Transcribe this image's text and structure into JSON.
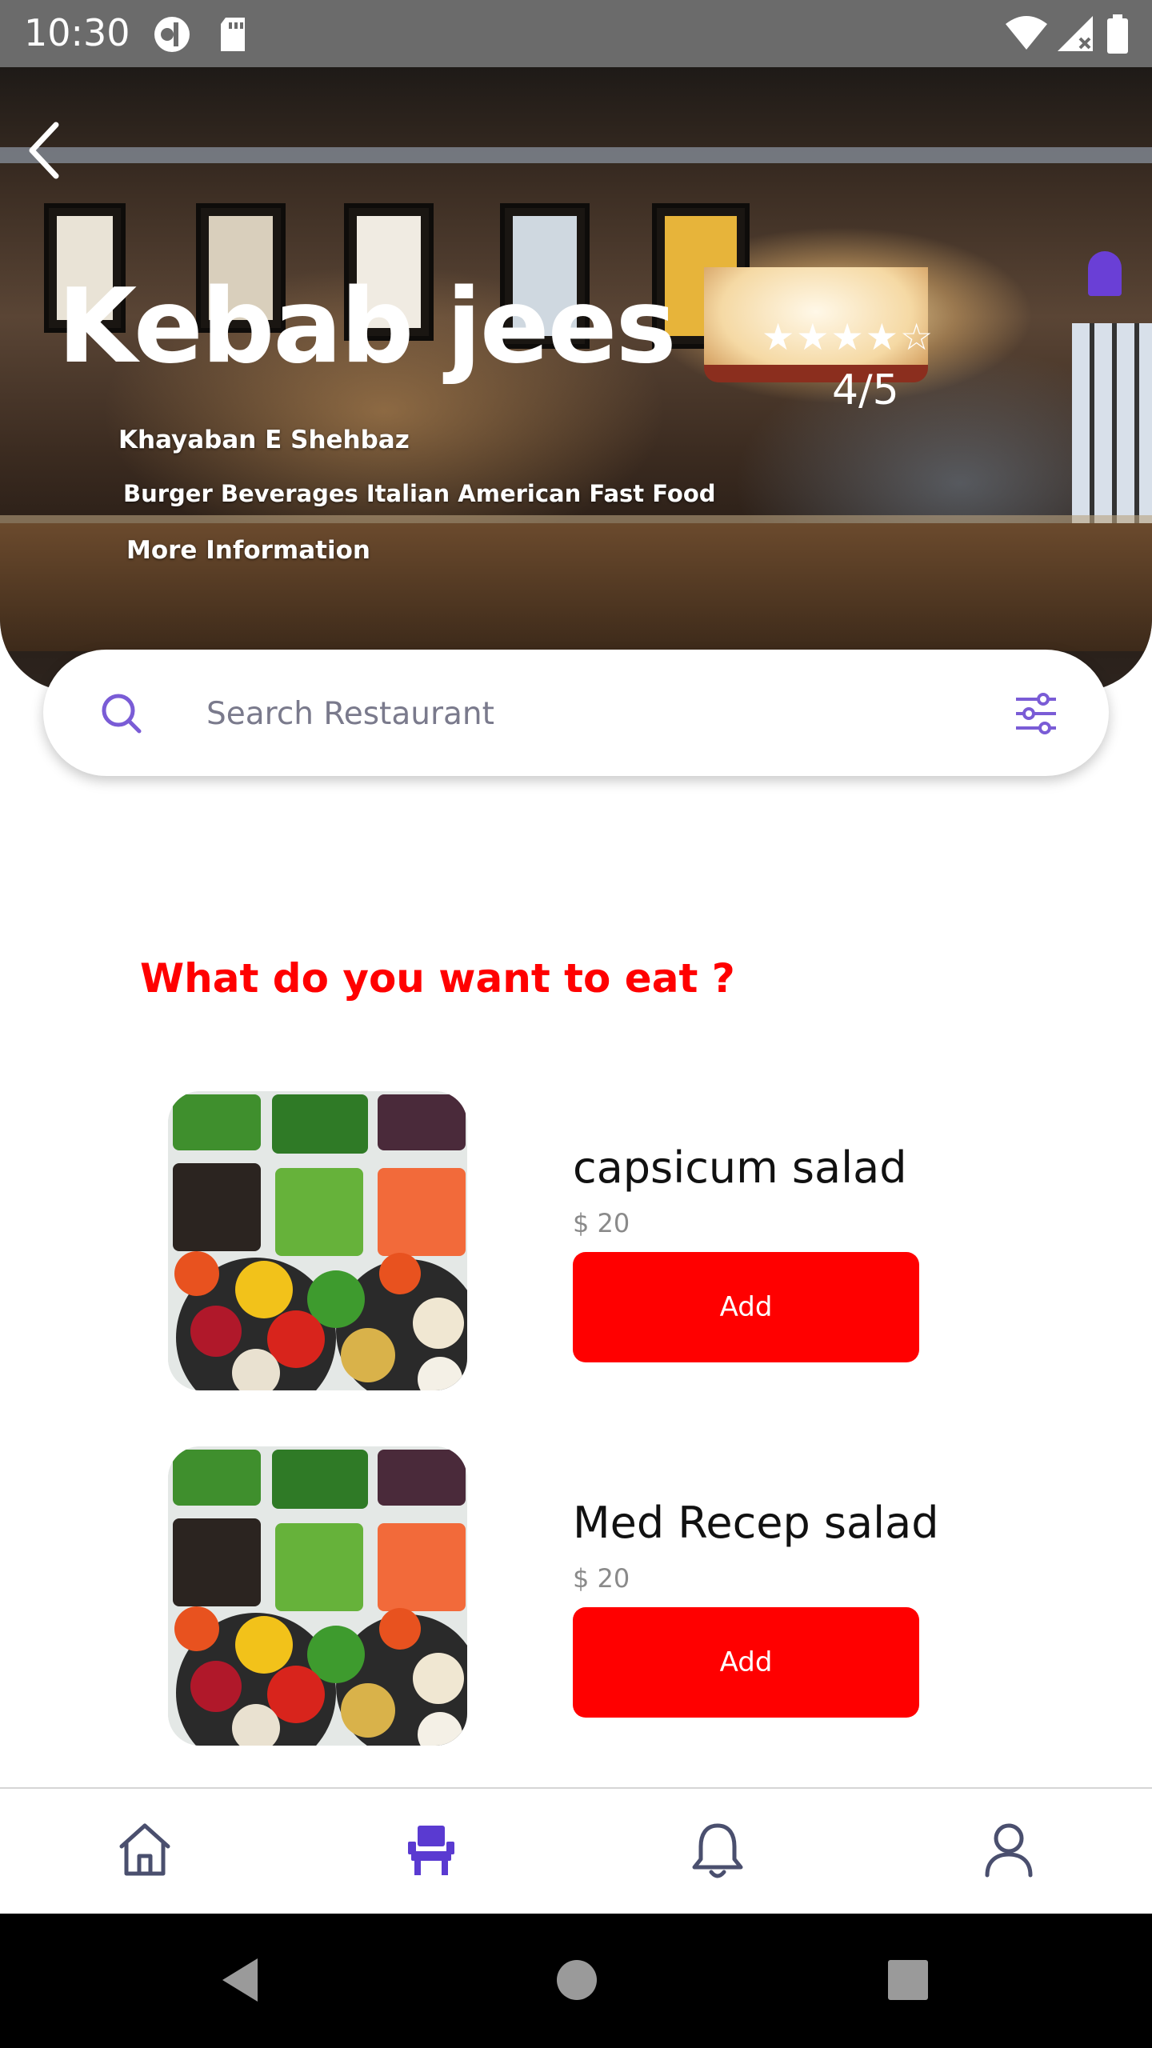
{
  "status_bar": {
    "time": "10:30"
  },
  "restaurant": {
    "name": "Kebab jees",
    "rating": 4,
    "rating_max": 5,
    "rating_text": "4/5",
    "location": "Khayaban E Shehbaz",
    "cuisines": "Burger Beverages Italian American Fast Food",
    "more_info": "More Information"
  },
  "search": {
    "placeholder": "Search Restaurant"
  },
  "section_title": "What do you want to eat ?",
  "items": [
    {
      "name": "capsicum salad",
      "price": "$ 20",
      "button": "Add"
    },
    {
      "name": "Med Recep salad",
      "price": "$ 20",
      "button": "Add"
    }
  ],
  "bottom_nav": [
    {
      "icon": "home-icon",
      "active": false
    },
    {
      "icon": "seat-icon",
      "active": true
    },
    {
      "icon": "bell-icon",
      "active": false
    },
    {
      "icon": "person-icon",
      "active": false
    }
  ],
  "colors": {
    "accent": "#ff0000",
    "nav_active": "#5a3ad1",
    "nav_inactive": "#4a4f6e",
    "search_icon": "#7a5cd6"
  }
}
